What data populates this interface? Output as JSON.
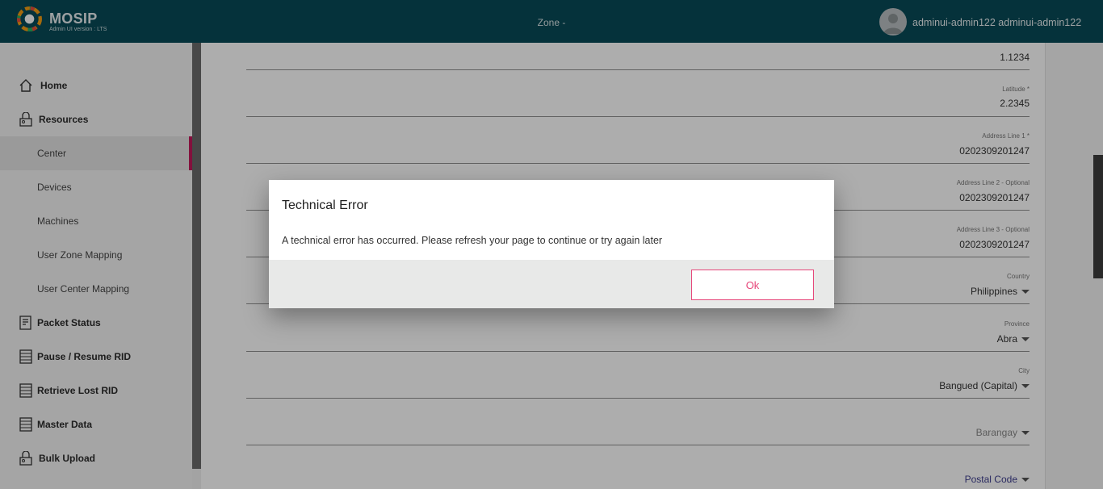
{
  "header": {
    "brand": "MOSIP",
    "version": "Admin UI version : LTS",
    "zone": "Zone -",
    "username": "adminui-admin122 adminui-admin122"
  },
  "sidebar": {
    "items": [
      {
        "label": "Home",
        "icon": "home-icon"
      },
      {
        "label": "Resources",
        "icon": "resources-icon"
      },
      {
        "label": "Center"
      },
      {
        "label": "Devices"
      },
      {
        "label": "Machines"
      },
      {
        "label": "User Zone Mapping"
      },
      {
        "label": "User Center Mapping"
      },
      {
        "label": "Packet Status",
        "icon": "packet-icon"
      },
      {
        "label": "Pause / Resume RID",
        "icon": "list-icon"
      },
      {
        "label": "Retrieve Lost RID",
        "icon": "list-icon"
      },
      {
        "label": "Master Data",
        "icon": "list-icon"
      },
      {
        "label": "Bulk Upload",
        "icon": "upload-icon"
      }
    ]
  },
  "form": {
    "longitude": {
      "value": "1.1234"
    },
    "latitude": {
      "label": "Latitude *",
      "value": "2.2345"
    },
    "address1": {
      "label": "Address Line 1 *",
      "value": "0202309201247"
    },
    "address2": {
      "label": "Address Line 2 - Optional",
      "value": "0202309201247"
    },
    "address3": {
      "label": "Address Line 3 - Optional",
      "value": "0202309201247"
    },
    "country": {
      "label": "Country",
      "value": "Philippines"
    },
    "province": {
      "label": "Province",
      "value": "Abra"
    },
    "city": {
      "label": "City",
      "value": "Bangued (Capital)"
    },
    "barangay": {
      "value": "Barangay"
    },
    "postal": {
      "value": "Postal Code"
    }
  },
  "dialog": {
    "title": "Technical Error",
    "message": "A technical error has occurred. Please refresh your page to continue or try again later",
    "ok_label": "Ok"
  },
  "colors": {
    "header_bg": "#084b57",
    "accent": "#e6477a",
    "active_marker": "#c2185b"
  }
}
